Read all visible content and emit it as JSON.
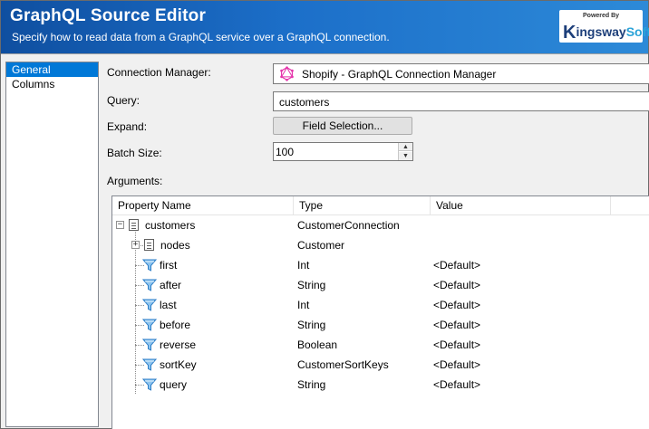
{
  "header": {
    "title": "GraphQL Source Editor",
    "subtitle": "Specify how to read data from a GraphQL service over a GraphQL connection.",
    "logo_powered": "Powered By",
    "logo_k": "K",
    "logo_ingsway": "ingsway",
    "logo_soft": "Soft"
  },
  "nav": {
    "items": [
      {
        "label": "General",
        "selected": true
      },
      {
        "label": "Columns",
        "selected": false
      }
    ]
  },
  "form": {
    "connection_manager_label": "Connection Manager:",
    "connection_manager_value": "Shopify - GraphQL Connection Manager",
    "query_label": "Query:",
    "query_value": "customers",
    "expand_label": "Expand:",
    "field_selection_button": "Field Selection...",
    "batch_size_label": "Batch Size:",
    "batch_size_value": "100",
    "arguments_label": "Arguments:"
  },
  "grid": {
    "columns": [
      "Property Name",
      "Type",
      "Value"
    ],
    "rows": [
      {
        "name": "customers",
        "type": "CustomerConnection",
        "value": "",
        "icon": "document-icon",
        "expander": "−"
      },
      {
        "name": "nodes",
        "type": "Customer",
        "value": "",
        "icon": "document-icon",
        "expander": "+"
      },
      {
        "name": "first",
        "type": "Int",
        "value": "<Default>",
        "icon": "filter-icon"
      },
      {
        "name": "after",
        "type": "String",
        "value": "<Default>",
        "icon": "filter-icon"
      },
      {
        "name": "last",
        "type": "Int",
        "value": "<Default>",
        "icon": "filter-icon"
      },
      {
        "name": "before",
        "type": "String",
        "value": "<Default>",
        "icon": "filter-icon"
      },
      {
        "name": "reverse",
        "type": "Boolean",
        "value": "<Default>",
        "icon": "filter-icon"
      },
      {
        "name": "sortKey",
        "type": "CustomerSortKeys",
        "value": "<Default>",
        "icon": "filter-icon"
      },
      {
        "name": "query",
        "type": "String",
        "value": "<Default>",
        "icon": "filter-icon"
      }
    ]
  },
  "colors": {
    "header_start": "#0f4fa0",
    "header_end": "#2d8ad8",
    "selection": "#0078d7",
    "graphql_pink": "#e535ab",
    "filter_blue": "#3a8fd9"
  }
}
